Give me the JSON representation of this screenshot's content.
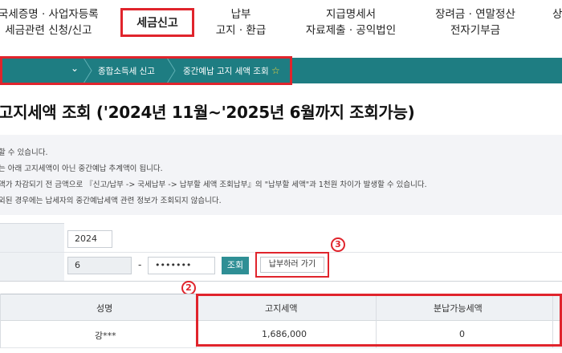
{
  "nav": {
    "item1_line1": "국세증명 · 사업자등록",
    "item1_line2": "세금관련 신청/신고",
    "active": "세금신고",
    "item3_line1": "납부",
    "item3_line2": "고지 · 환급",
    "item4_line1": "지급명세서",
    "item4_line2": "자료제출 · 공익법인",
    "item5_line1": "장려금 · 연말정산",
    "item5_line2": "전자기부금",
    "item6_partial": "상"
  },
  "breadcrumb": {
    "chevron": "⌄",
    "level1": "종합소득세 신고",
    "level2": "중간예납 고지 세액 조회",
    "favorite_icon": "star-icon"
  },
  "page": {
    "title": "고지세액 조회 ('2024년 11월~'2025년 6월까지 조회가능)"
  },
  "notice": {
    "line1": "할 수 있습니다.",
    "line2": "는 아래 고지세액이 아닌 중간예납 추계액이 됩니다.",
    "line3": "액가 차감되기 전 금액으로 『신고/납부 -> 국세납부 -> 납부할 세액 조회납부』의 \"납부할 세액\"과 1천원 차이가 발생할 수 있습니다.",
    "line4": "외된 경우에는 납세자의 중간예납세액 관련 정보가 조회되지 않습니다."
  },
  "form": {
    "year_value": "2024",
    "id_front": "6",
    "dash": "-",
    "id_back": "•••••••",
    "search_button": "조회",
    "pay_button": "납부하러 가기"
  },
  "callouts": {
    "c2": "2",
    "c3": "3"
  },
  "table": {
    "headers": [
      "성명",
      "고지세액",
      "분납가능세액"
    ],
    "row": {
      "name": "강***",
      "notice_tax": "1,686,000",
      "installment_tax": "0"
    }
  },
  "colors": {
    "brand": "#1e7d82",
    "highlight": "#e0242c",
    "button": "#2f8f95"
  }
}
